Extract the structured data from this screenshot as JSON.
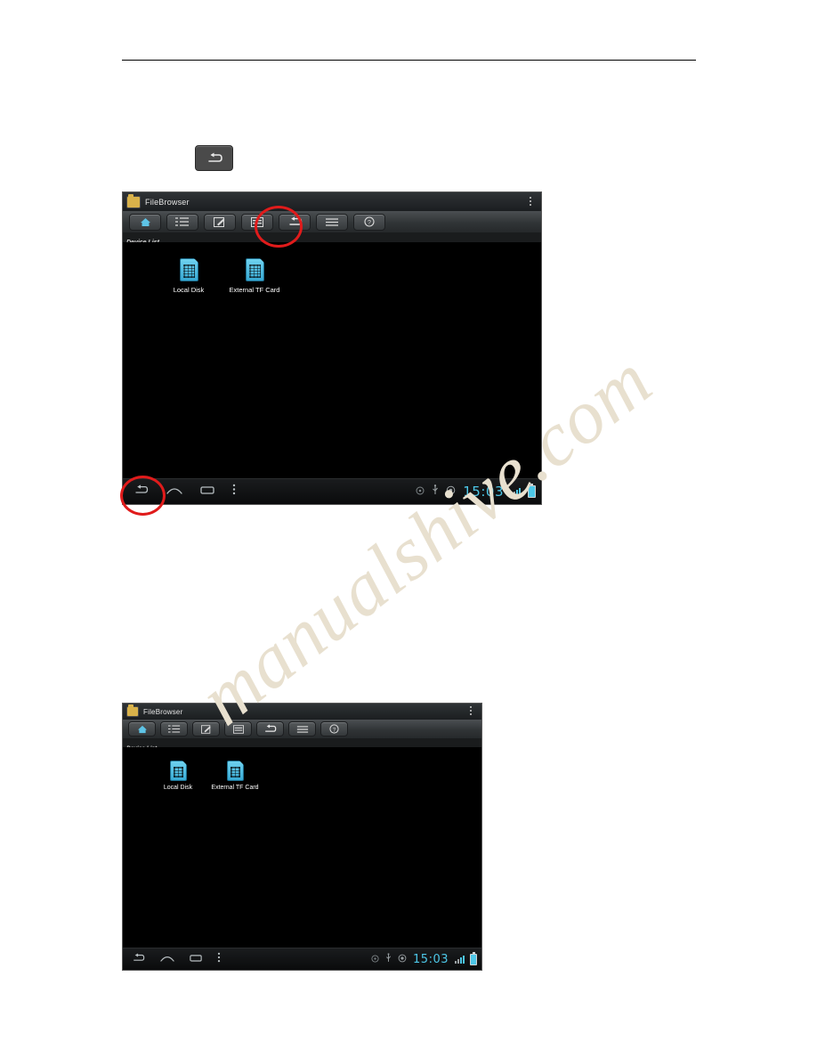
{
  "page": {
    "watermark_text": "manualshive.com"
  },
  "standalone_icon": {
    "name": "back-key-icon",
    "glyph": "↩"
  },
  "screenshot_top": {
    "app_title": "FileBrowser",
    "section_label": "Device List",
    "toolbar_buttons": [
      {
        "name": "home-icon",
        "glyph": "⌂"
      },
      {
        "name": "list-view-icon",
        "glyph": "☰"
      },
      {
        "name": "edit-icon",
        "glyph": "✎"
      },
      {
        "name": "window-icon",
        "glyph": "▤"
      },
      {
        "name": "back-icon",
        "glyph": "↩"
      },
      {
        "name": "menu-icon",
        "glyph": "≡"
      },
      {
        "name": "help-icon",
        "glyph": "?"
      }
    ],
    "drives": [
      {
        "label": "Local Disk",
        "icon": "storage-card-icon"
      },
      {
        "label": "External TF Card",
        "icon": "storage-card-icon"
      }
    ],
    "navbar": {
      "buttons": [
        {
          "name": "nav-back-icon",
          "glyph": "↩"
        },
        {
          "name": "nav-home-icon",
          "glyph": "⌂"
        },
        {
          "name": "nav-recents-icon",
          "glyph": "▭"
        },
        {
          "name": "nav-overflow-icon",
          "glyph": "⋮"
        }
      ],
      "status_icons": [
        {
          "name": "screenshot-icon",
          "glyph": "◎"
        },
        {
          "name": "usb-icon",
          "glyph": "⑂"
        },
        {
          "name": "volume-icon",
          "glyph": "◉"
        }
      ],
      "clock": "15:03"
    }
  },
  "screenshot_bottom": {
    "app_title": "FileBrowser",
    "section_label": "Device List",
    "toolbar_buttons": [
      {
        "name": "home-icon",
        "glyph": "⌂"
      },
      {
        "name": "list-view-icon",
        "glyph": "☰"
      },
      {
        "name": "edit-icon",
        "glyph": "✎"
      },
      {
        "name": "window-icon",
        "glyph": "▤"
      },
      {
        "name": "back-icon",
        "glyph": "↩"
      },
      {
        "name": "menu-icon",
        "glyph": "≡"
      },
      {
        "name": "help-icon",
        "glyph": "?"
      }
    ],
    "drives": [
      {
        "label": "Local Disk",
        "icon": "storage-card-icon"
      },
      {
        "label": "External TF Card",
        "icon": "storage-card-icon"
      }
    ],
    "navbar": {
      "buttons": [
        {
          "name": "nav-back-icon",
          "glyph": "↩"
        },
        {
          "name": "nav-home-icon",
          "glyph": "⌂"
        },
        {
          "name": "nav-recents-icon",
          "glyph": "▭"
        },
        {
          "name": "nav-overflow-icon",
          "glyph": "⋮"
        }
      ],
      "status_icons": [
        {
          "name": "screenshot-icon",
          "glyph": "◎"
        },
        {
          "name": "usb-icon",
          "glyph": "⑂"
        },
        {
          "name": "volume-icon",
          "glyph": "◉"
        }
      ],
      "clock": "15:03"
    }
  },
  "colors": {
    "annotation": "#e01b1b",
    "accent_cyan": "#4dc7e8",
    "drive_icon": "#37a9d4"
  }
}
